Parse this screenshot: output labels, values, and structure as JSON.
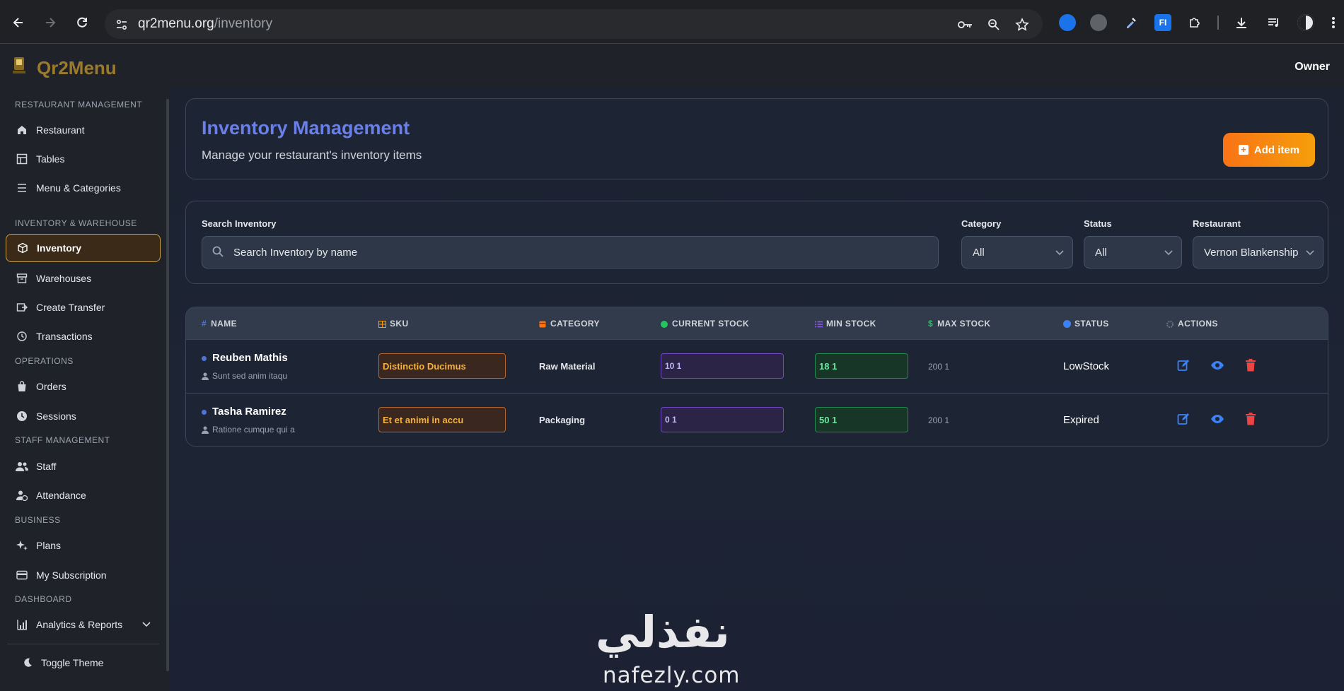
{
  "browser": {
    "url_host": "qr2menu.org",
    "url_path": "/inventory"
  },
  "header": {
    "brand": "Qr2Menu",
    "user": "Owner"
  },
  "sidebar": {
    "sections": {
      "restaurant": "RESTAURANT MANAGEMENT",
      "inventory": "INVENTORY & WAREHOUSE",
      "operations": "OPERATIONS",
      "staff": "STAFF MANAGEMENT",
      "business": "BUSINESS",
      "dashboard": "DASHBOARD"
    },
    "items": {
      "restaurant": "Restaurant",
      "tables": "Tables",
      "menu": "Menu & Categories",
      "inventory": "Inventory",
      "warehouses": "Warehouses",
      "transfer": "Create Transfer",
      "transactions": "Transactions",
      "orders": "Orders",
      "sessions": "Sessions",
      "staff": "Staff",
      "attendance": "Attendance",
      "plans": "Plans",
      "subscription": "My Subscription",
      "analytics": "Analytics & Reports",
      "theme": "Toggle Theme"
    }
  },
  "page": {
    "title": "Inventory Management",
    "subtitle": "Manage your restaurant's inventory items",
    "add_button": "Add item"
  },
  "filters": {
    "search_label": "Search Inventory",
    "search_placeholder": "Search Inventory by name",
    "category_label": "Category",
    "category_value": "All",
    "status_label": "Status",
    "status_value": "All",
    "restaurant_label": "Restaurant",
    "restaurant_value": "Vernon Blankenship"
  },
  "table": {
    "headers": {
      "name": "NAME",
      "sku": "SKU",
      "category": "CATEGORY",
      "current_stock": "CURRENT STOCK",
      "min_stock": "MIN STOCK",
      "max_stock": "MAX STOCK",
      "status": "STATUS",
      "actions": "ACTIONS"
    },
    "rows": [
      {
        "name": "Reuben Mathis",
        "description": "Sunt sed anim itaqu",
        "sku": "Distinctio Ducimus",
        "category": "Raw Material",
        "current_stock": "10 1",
        "min_stock": "18 1",
        "max_stock": "200 1",
        "status": "LowStock"
      },
      {
        "name": "Tasha Ramirez",
        "description": "Ratione cumque qui a",
        "sku": "Et et animi in accu",
        "category": "Packaging",
        "current_stock": "0 1",
        "min_stock": "50 1",
        "max_stock": "200 1",
        "status": "Expired"
      }
    ]
  },
  "watermark": {
    "arabic": "نفذلي",
    "latin": "nafezly.com"
  },
  "colors": {
    "brand": "#9b7a2e",
    "title_accent": "#6b7fe8",
    "add_button": "#f97316",
    "active_border": "#c8a24a"
  }
}
